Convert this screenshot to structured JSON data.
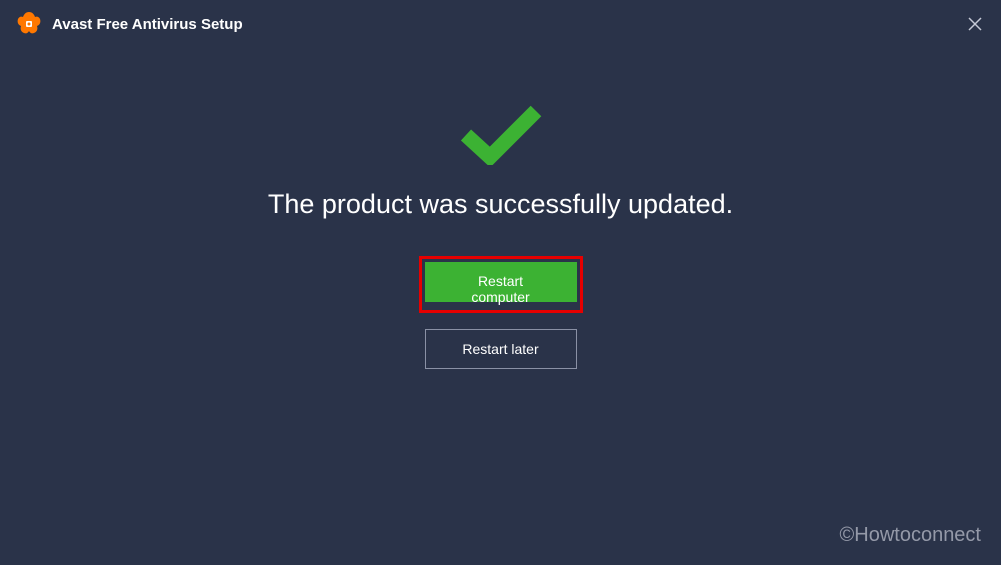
{
  "header": {
    "title": "Avast Free Antivirus Setup"
  },
  "main": {
    "message": "The product was successfully updated.",
    "primary_button_label": "Restart computer",
    "secondary_button_label": "Restart later"
  },
  "watermark": "©Howtoconnect",
  "colors": {
    "background": "#2a3349",
    "accent_green": "#3cb233",
    "highlight_red": "#e60000",
    "logo_orange": "#ff7800"
  }
}
